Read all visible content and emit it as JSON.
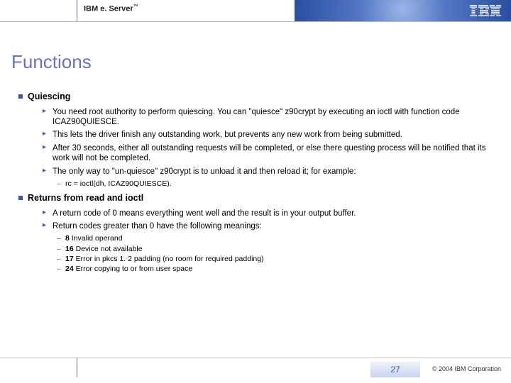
{
  "header": {
    "product": "IBM e. Server",
    "tm": "™"
  },
  "title": "Functions",
  "sections": [
    {
      "heading": "Quiescing",
      "bullets": [
        "You need root authority to perform quiescing. You can \"quiesce\" z90crypt by executing an ioctl with function code ICAZ90QUIESCE.",
        "This lets the driver finish any outstanding work, but prevents any new work from being submitted.",
        "After 30 seconds, either all outstanding requests will be completed, or else there questing process will be notified that its work will not be completed.",
        "The only way to \"un-quiesce\" z90crypt is to unload it and then reload it; for example:"
      ],
      "subdash": [
        "rc = ioctl(dh, ICAZ90QUIESCE)."
      ]
    },
    {
      "heading": "Returns from read and ioctl",
      "bullets": [
        "A return code of 0 means everything went well and the result is in your output buffer.",
        "Return codes greater than 0 have the following meanings:"
      ],
      "subdash": [
        {
          "code": "8",
          "text": " Invalid operand"
        },
        {
          "code": "16",
          "text": " Device not available"
        },
        {
          "code": "17",
          "text": " Error in pkcs 1. 2 padding (no room for required padding)"
        },
        {
          "code": "24",
          "text": " Error copying to or from user space"
        }
      ]
    }
  ],
  "footer": {
    "page": "27",
    "copyright": "© 2004 IBM Corporation"
  }
}
